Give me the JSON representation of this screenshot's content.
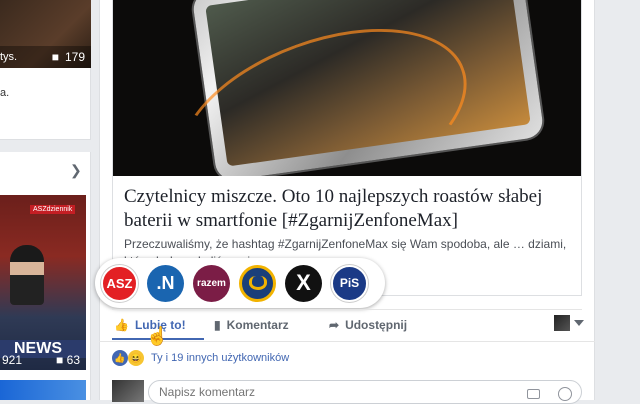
{
  "left_column": {
    "thumb_cut_text": "tys.",
    "thumb_comment_count": "179",
    "card_fragment": "a.",
    "news_badge": "ASZdziennik",
    "news_ticker": "NEWS",
    "news_left_count": "921",
    "news_comment_count": "63"
  },
  "post": {
    "link_title": "Czytelnicy miszcze. Oto 10 najlepszych roastów słabej baterii w smartfonie [#ZgarnijZenfoneMax]",
    "link_description": "Przeczuwaliśmy, że hashtag #ZgarnijZenfoneMax się Wam spodoba, ale … dziami, których doszukaliśmy się…"
  },
  "reactions": [
    {
      "label": "ASZ"
    },
    {
      "label": ".N"
    },
    {
      "label": "razem"
    },
    {
      "label": ""
    },
    {
      "label": "X"
    },
    {
      "label": "PiS"
    }
  ],
  "actions": {
    "like": "Lubię to!",
    "comment": "Komentarz",
    "share": "Udostępnij"
  },
  "likes_summary": "Ty i 19 innych użytkowników",
  "comment_placeholder": "Napisz komentarz",
  "colors": {
    "brand_blue": "#4267b2",
    "background": "#e9ebee"
  }
}
